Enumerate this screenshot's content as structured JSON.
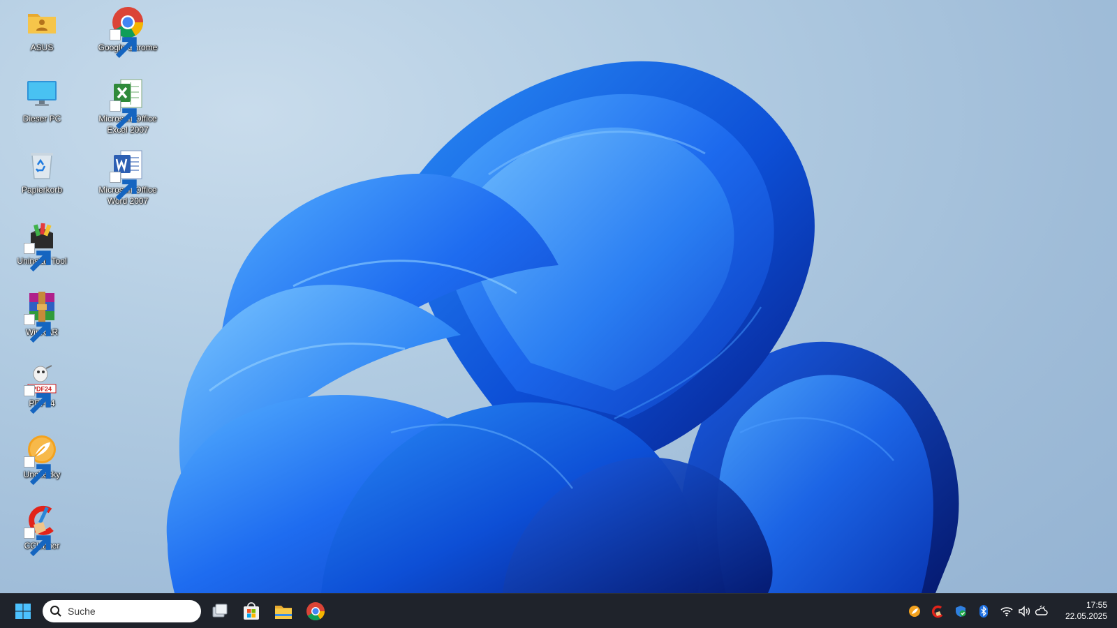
{
  "desktop": {
    "icons": [
      {
        "label": "ASUS",
        "icon": "user-folder-icon",
        "shortcut": false
      },
      {
        "label": "Google Chrome",
        "icon": "chrome-icon",
        "shortcut": true
      },
      {
        "label": "Dieser PC",
        "icon": "monitor-icon",
        "shortcut": false
      },
      {
        "label": "Microsoft Office Excel 2007",
        "icon": "excel-icon",
        "shortcut": true
      },
      {
        "label": "Papierkorb",
        "icon": "recycle-bin-icon",
        "shortcut": false
      },
      {
        "label": "Microsoft Office Word 2007",
        "icon": "word-icon",
        "shortcut": true
      },
      {
        "label": "Uninstall Tool",
        "icon": "uninstall-tool-icon",
        "shortcut": true
      },
      {
        "label": "WinRAR",
        "icon": "winrar-icon",
        "shortcut": true
      },
      {
        "label": "PDF24",
        "icon": "pdf24-icon",
        "shortcut": true
      },
      {
        "label": "Unchecky",
        "icon": "unchecky-icon",
        "shortcut": true
      },
      {
        "label": "CCleaner",
        "icon": "ccleaner-icon",
        "shortcut": true
      }
    ],
    "pdf24_badge": "PDF24"
  },
  "taskbar": {
    "search_placeholder": "Suche",
    "pinned": [
      "windows-start-icon",
      "task-view-icon",
      "microsoft-store-icon",
      "file-explorer-icon",
      "chrome-icon"
    ],
    "tray": [
      "unchecky-tray-icon",
      "ccleaner-tray-icon",
      "windows-security-icon",
      "bluetooth-icon",
      "wifi-icon",
      "volume-icon",
      "onedrive-icon"
    ],
    "clock_time": "17:55",
    "clock_date": "22.05.2025"
  },
  "colors": {
    "taskbar": "#1f232b",
    "accent_blue": "#1e6cf0",
    "wallpaper_bg": "#b2cce2"
  }
}
